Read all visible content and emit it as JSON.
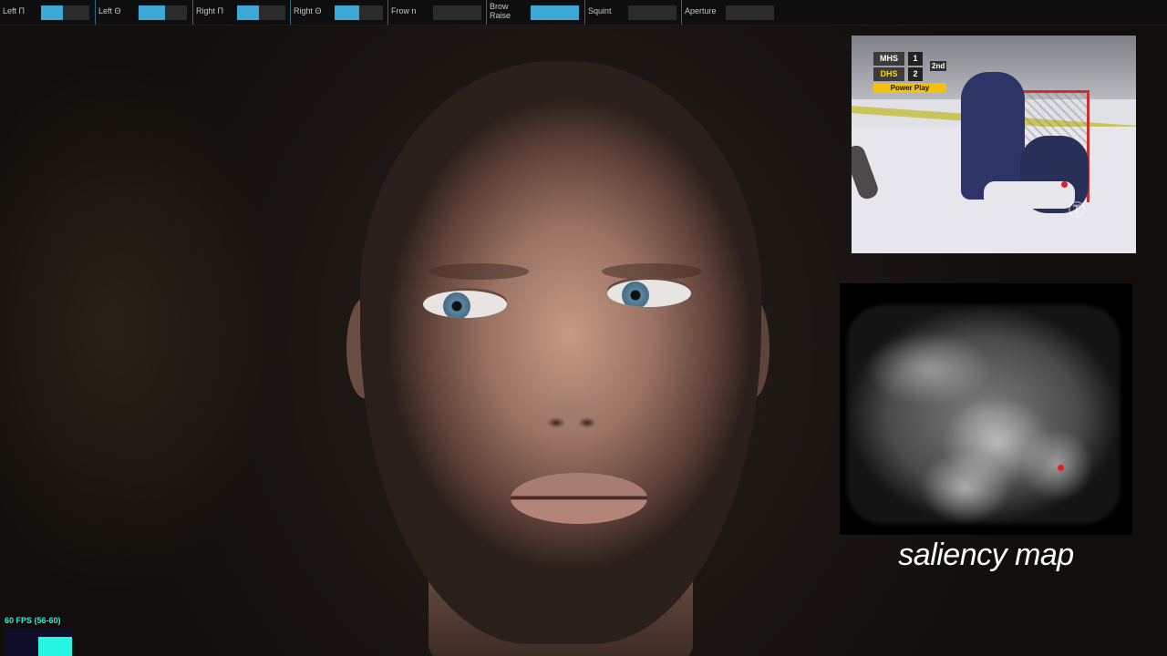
{
  "controls": [
    {
      "label": "Left Π",
      "value": 0.45
    },
    {
      "label": "Left Θ",
      "value": 0.55
    },
    {
      "label": "Right Π",
      "value": 0.45
    },
    {
      "label": "Right Θ",
      "value": 0.5
    },
    {
      "label": "Frow n",
      "value": 0.0
    },
    {
      "label": "Brow Raise",
      "value": 1.0
    },
    {
      "label": "Squint",
      "value": 0.0
    },
    {
      "label": "Aperture",
      "value": 0.0
    }
  ],
  "video": {
    "scoreboard": {
      "team1": "MHS",
      "score1": "1",
      "team2": "DHS",
      "score2": "2",
      "period": "2nd",
      "banner": "Power Play"
    },
    "watermark": "Ⓣ"
  },
  "saliency": {
    "caption": "saliency map"
  },
  "fps": {
    "text": "60 FPS (56-60)"
  },
  "colors": {
    "slider_fill": "#3ba8d6",
    "slider_track": "#2b2b2b",
    "fps_text": "#3ee6d6",
    "fixation_dot": "#e01e2a"
  }
}
